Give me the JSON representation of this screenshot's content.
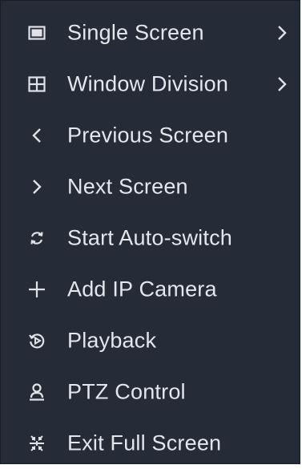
{
  "menu": {
    "items": [
      {
        "label": "Single Screen",
        "icon": "monitor-icon",
        "has_submenu": true
      },
      {
        "label": "Window Division",
        "icon": "grid-icon",
        "has_submenu": true
      },
      {
        "label": "Previous Screen",
        "icon": "chevron-left-icon",
        "has_submenu": false
      },
      {
        "label": "Next Screen",
        "icon": "chevron-right-icon",
        "has_submenu": false
      },
      {
        "label": "Start Auto-switch",
        "icon": "cycle-arrows-icon",
        "has_submenu": false
      },
      {
        "label": "Add IP Camera",
        "icon": "plus-icon",
        "has_submenu": false
      },
      {
        "label": "Playback",
        "icon": "playback-icon",
        "has_submenu": false
      },
      {
        "label": "PTZ Control",
        "icon": "ptz-person-icon",
        "has_submenu": false
      },
      {
        "label": "Exit Full Screen",
        "icon": "exit-fullscreen-icon",
        "has_submenu": false
      }
    ]
  },
  "colors": {
    "background": "#262b38",
    "text": "#e3e6ec",
    "icon": "#dfe2e8"
  }
}
